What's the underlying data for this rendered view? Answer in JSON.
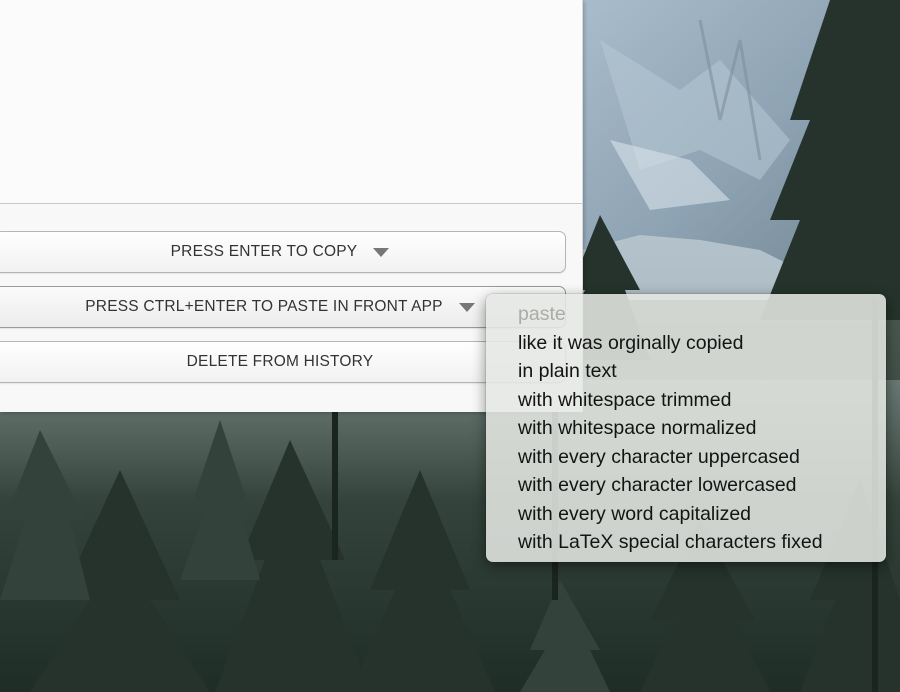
{
  "app": {
    "buttons": {
      "copy_label": "PRESS ENTER TO COPY",
      "paste_label": "PRESS CTRL+ENTER TO PASTE IN FRONT APP",
      "delete_label": "DELETE FROM HISTORY"
    }
  },
  "paste_menu": {
    "header": "paste",
    "items": [
      "like it was orginally copied",
      "in plain text",
      "with whitespace trimmed",
      "with whitespace normalized",
      "with every character uppercased",
      "with every character lowercased",
      "with every word capitalized",
      "with LaTeX special characters fixed"
    ]
  },
  "colors": {
    "window_bg": "#f8f8f8",
    "button_text": "#333333",
    "menu_bg": "#e4e7e2",
    "menu_header": "#a9aca7"
  },
  "icons": {
    "dropdown": "chevron-down-icon"
  }
}
